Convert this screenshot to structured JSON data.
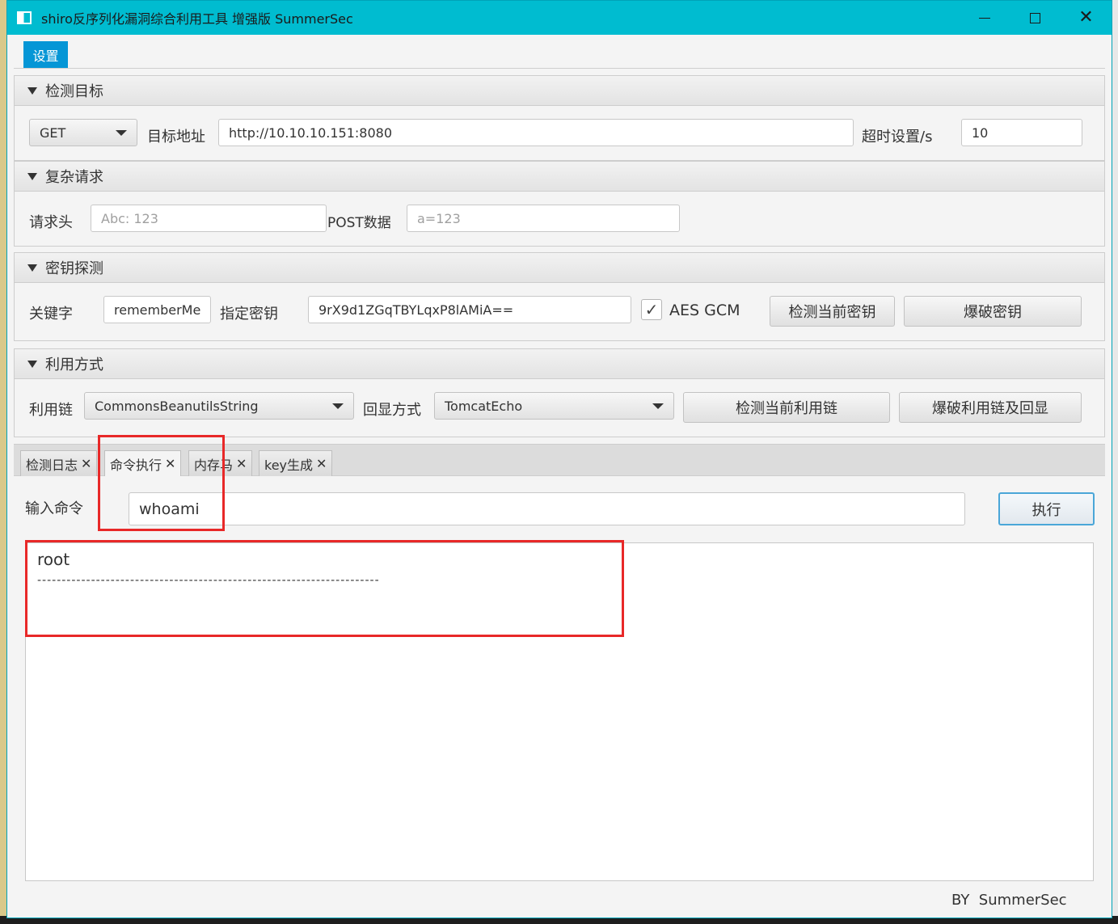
{
  "window": {
    "title": "shiro反序列化漏洞综合利用工具 增强版 SummerSec",
    "minimize": "",
    "maximize": "",
    "close": "✕"
  },
  "menu": {
    "settings": "设置"
  },
  "target": {
    "section_title": "检测目标",
    "method": "GET",
    "url_label": "目标地址",
    "url_value": "http://10.10.10.151:8080",
    "timeout_label": "超时设置/s",
    "timeout_value": "10"
  },
  "complex": {
    "section_title": "复杂请求",
    "header_label": "请求头",
    "header_placeholder": "Abc: 123",
    "post_label": "POST数据",
    "post_placeholder": "a=123"
  },
  "key": {
    "section_title": "密钥探测",
    "keyword_label": "关键字",
    "keyword_value": "rememberMe",
    "specify_label": "指定密钥",
    "specify_value": "9rX9d1ZGqTBYLqxP8lAMiA==",
    "aes_gcm_checked": "✓",
    "aes_gcm_label": "AES GCM",
    "detect_button": "检测当前密钥",
    "brute_button": "爆破密钥"
  },
  "exploit": {
    "section_title": "利用方式",
    "chain_label": "利用链",
    "chain_value": "CommonsBeanutilsString",
    "echo_label": "回显方式",
    "echo_value": "TomcatEcho",
    "detect_button": "检测当前利用链",
    "brute_button": "爆破利用链及回显"
  },
  "tabs": [
    {
      "label": "检测日志",
      "close": "✕"
    },
    {
      "label": "命令执行",
      "close": "✕"
    },
    {
      "label": "内存马",
      "close": "✕"
    },
    {
      "label": "key生成",
      "close": "✕"
    }
  ],
  "command": {
    "input_label": "输入命令",
    "input_value": "whoami",
    "execute_button": "执行",
    "output_lines": [
      "root",
      "----------------------------------------------------------------------"
    ]
  },
  "footer": "BY  SummerSec",
  "colors": {
    "titlebar": "#00bcd0",
    "menu_active": "#0596d6",
    "highlight": "#e82828",
    "exec_border": "#4aa6d8"
  }
}
